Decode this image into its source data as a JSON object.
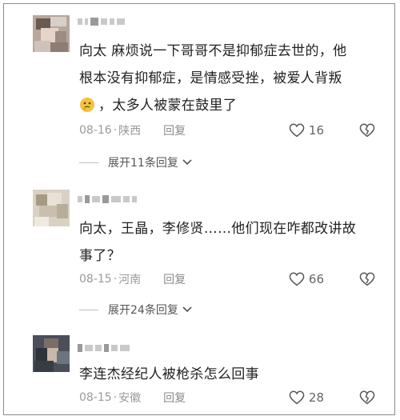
{
  "comments": [
    {
      "text_lines": [
        "向太 麻烦说一下哥哥不是抑郁症去世的，他",
        "根本没有抑郁症，是情感受挫，被爱人背叛",
        "，太多人被蒙在鼓里了"
      ],
      "emoji": "thinking-face",
      "date": "08-16",
      "location": "陕西",
      "reply_label": "回复",
      "likes": "16",
      "expand_label": "展开11条回复"
    },
    {
      "text_lines": [
        "向太，王晶，李修贤……他们现在咋都改讲故",
        "事了？"
      ],
      "date": "08-15",
      "location": "河南",
      "reply_label": "回复",
      "likes": "66",
      "expand_label": "展开24条回复"
    },
    {
      "text_lines": [
        "李连杰经纪人被枪杀怎么回事"
      ],
      "date": "08-15",
      "location": "安徽",
      "reply_label": "回复",
      "likes": "28"
    }
  ],
  "separator": "·",
  "icons": {
    "like": "heart-outline-icon",
    "dislike": "broken-heart-icon",
    "expand": "chevron-down-icon"
  },
  "colors": {
    "text": "#222222",
    "meta": "#9a9a9a",
    "icon": "#555555"
  }
}
